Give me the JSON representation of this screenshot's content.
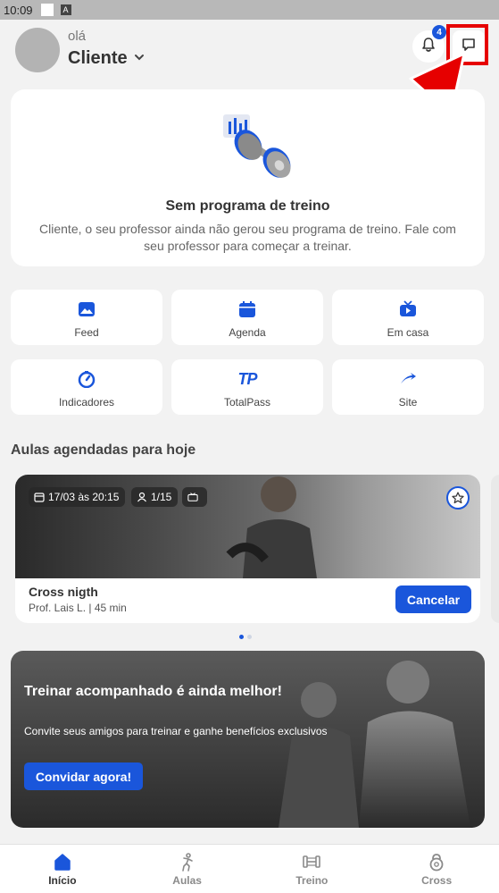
{
  "status_bar": {
    "time": "10:09"
  },
  "header": {
    "greeting": "olá",
    "user_name": "Cliente",
    "notification_count": "4"
  },
  "empty_program": {
    "title": "Sem programa de treino",
    "description": "Cliente, o seu professor ainda não gerou seu programa de treino. Fale com seu professor para começar a treinar."
  },
  "shortcuts": [
    {
      "label": "Feed",
      "icon": "image-icon"
    },
    {
      "label": "Agenda",
      "icon": "calendar-icon"
    },
    {
      "label": "Em casa",
      "icon": "tv-play-icon"
    },
    {
      "label": "Indicadores",
      "icon": "gauge-icon"
    },
    {
      "label": "TotalPass",
      "icon": "totalpass-logo-icon",
      "logo_text": "TP"
    },
    {
      "label": "Site",
      "icon": "external-arrow-icon"
    }
  ],
  "scheduled": {
    "section_title": "Aulas agendadas para hoje",
    "classes": [
      {
        "date_time": "17/03 às 20:15",
        "capacity": "1/15",
        "name": "Cross nigth",
        "meta": "Prof. Lais L. | 45 min",
        "cancel_label": "Cancelar"
      }
    ]
  },
  "promo": {
    "title": "Treinar acompanhado é ainda melhor!",
    "subtitle": "Convite seus amigos para treinar e ganhe benefícios exclusivos",
    "button_label": "Convidar agora!"
  },
  "bottom_nav": [
    {
      "label": "Início",
      "icon": "home-icon",
      "active": true
    },
    {
      "label": "Aulas",
      "icon": "person-exercise-icon",
      "active": false
    },
    {
      "label": "Treino",
      "icon": "dumbbell-icon",
      "active": false
    },
    {
      "label": "Cross",
      "icon": "kettlebell-icon",
      "active": false
    }
  ],
  "colors": {
    "accent": "#1a56db",
    "annotation_red": "#e60000",
    "background": "#f2f2f2"
  }
}
